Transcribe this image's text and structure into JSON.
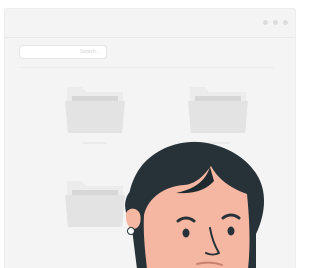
{
  "search": {
    "placeholder": "Search..."
  },
  "colors": {
    "window_bg": "#f4f4f4",
    "folder": "#e6e6e6",
    "hair": "#263238",
    "skin": "#f5b7a1",
    "earring": "#ffffff"
  },
  "icons": {
    "window_controls": "ellipsis-dots",
    "folders": "folder-icon",
    "person": "person-illustration"
  }
}
